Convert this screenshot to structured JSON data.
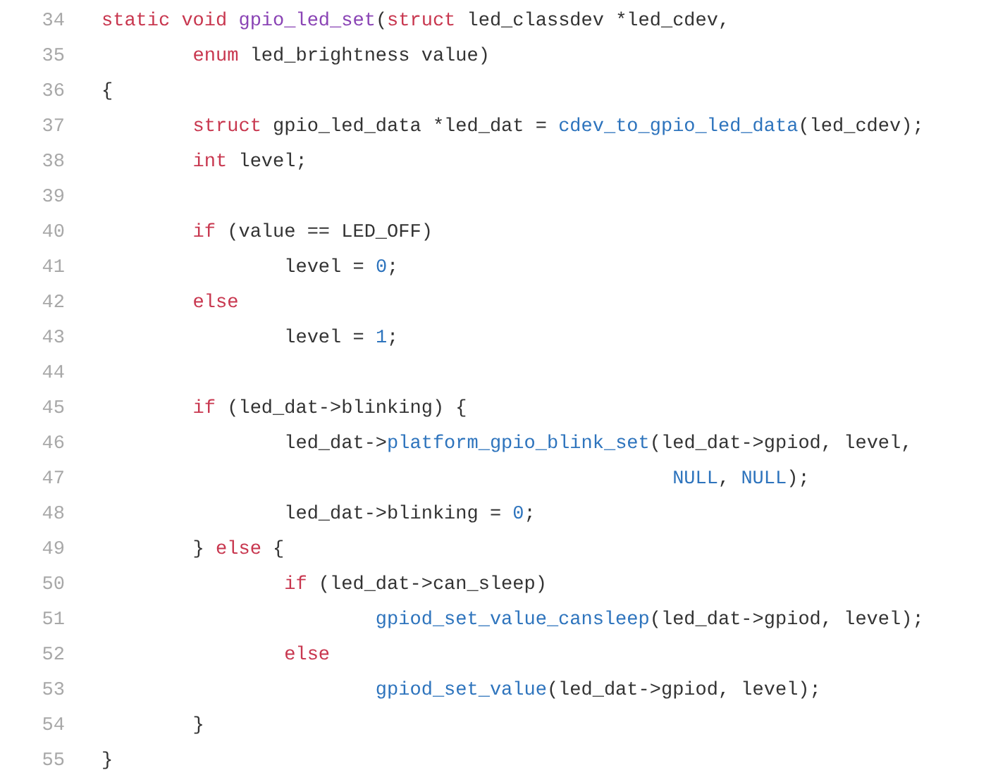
{
  "code_listing": {
    "lines": [
      {
        "number": "34",
        "tokens": [
          {
            "kind": "keyword",
            "text": "static void "
          },
          {
            "kind": "definition",
            "text": "gpio_led_set"
          },
          {
            "kind": "plain",
            "text": "("
          },
          {
            "kind": "keyword",
            "text": "struct"
          },
          {
            "kind": "plain",
            "text": " led_classdev *led_cdev,"
          }
        ]
      },
      {
        "number": "35",
        "tokens": [
          {
            "kind": "keyword",
            "text": "        enum"
          },
          {
            "kind": "plain",
            "text": " led_brightness value)"
          }
        ]
      },
      {
        "number": "36",
        "tokens": [
          {
            "kind": "plain",
            "text": "{"
          }
        ]
      },
      {
        "number": "37",
        "tokens": [
          {
            "kind": "keyword",
            "text": "        struct"
          },
          {
            "kind": "plain",
            "text": " gpio_led_data *led_dat = "
          },
          {
            "kind": "call",
            "text": "cdev_to_gpio_led_data"
          },
          {
            "kind": "plain",
            "text": "(led_cdev);"
          }
        ]
      },
      {
        "number": "38",
        "tokens": [
          {
            "kind": "keyword",
            "text": "        int"
          },
          {
            "kind": "plain",
            "text": " level;"
          }
        ]
      },
      {
        "number": "39"
      },
      {
        "number": "40",
        "tokens": [
          {
            "kind": "keyword",
            "text": "        if"
          },
          {
            "kind": "plain",
            "text": " (value == LED_OFF)"
          }
        ]
      },
      {
        "number": "41",
        "tokens": [
          {
            "kind": "plain",
            "text": "                level = "
          },
          {
            "kind": "number",
            "text": "0"
          },
          {
            "kind": "plain",
            "text": ";"
          }
        ]
      },
      {
        "number": "42",
        "tokens": [
          {
            "kind": "keyword",
            "text": "        else"
          }
        ]
      },
      {
        "number": "43",
        "tokens": [
          {
            "kind": "plain",
            "text": "                level = "
          },
          {
            "kind": "number",
            "text": "1"
          },
          {
            "kind": "plain",
            "text": ";"
          }
        ]
      },
      {
        "number": "44"
      },
      {
        "number": "45",
        "tokens": [
          {
            "kind": "keyword",
            "text": "        if"
          },
          {
            "kind": "plain",
            "text": " (led_dat->blinking) {"
          }
        ]
      },
      {
        "number": "46",
        "tokens": [
          {
            "kind": "plain",
            "text": "                led_dat->"
          },
          {
            "kind": "call",
            "text": "platform_gpio_blink_set"
          },
          {
            "kind": "plain",
            "text": "(led_dat->gpiod, level,"
          }
        ]
      },
      {
        "number": "47",
        "tokens": [
          {
            "kind": "call",
            "text": "                                                  NULL"
          },
          {
            "kind": "plain",
            "text": ", "
          },
          {
            "kind": "call",
            "text": "NULL"
          },
          {
            "kind": "plain",
            "text": ");"
          }
        ]
      },
      {
        "number": "48",
        "tokens": [
          {
            "kind": "plain",
            "text": "                led_dat->blinking = "
          },
          {
            "kind": "number",
            "text": "0"
          },
          {
            "kind": "plain",
            "text": ";"
          }
        ]
      },
      {
        "number": "49",
        "tokens": [
          {
            "kind": "plain",
            "text": "        } "
          },
          {
            "kind": "keyword",
            "text": "else"
          },
          {
            "kind": "plain",
            "text": " {"
          }
        ]
      },
      {
        "number": "50",
        "tokens": [
          {
            "kind": "keyword",
            "text": "                if"
          },
          {
            "kind": "plain",
            "text": " (led_dat->can_sleep)"
          }
        ]
      },
      {
        "number": "51",
        "tokens": [
          {
            "kind": "call",
            "text": "                        gpiod_set_value_cansleep"
          },
          {
            "kind": "plain",
            "text": "(led_dat->gpiod, level);"
          }
        ]
      },
      {
        "number": "52",
        "tokens": [
          {
            "kind": "keyword",
            "text": "                else"
          }
        ]
      },
      {
        "number": "53",
        "tokens": [
          {
            "kind": "call",
            "text": "                        gpiod_set_value"
          },
          {
            "kind": "plain",
            "text": "(led_dat->gpiod, level);"
          }
        ]
      },
      {
        "number": "54",
        "tokens": [
          {
            "kind": "plain",
            "text": "        }"
          }
        ]
      },
      {
        "number": "55",
        "tokens": [
          {
            "kind": "plain",
            "text": "}"
          }
        ]
      }
    ]
  }
}
